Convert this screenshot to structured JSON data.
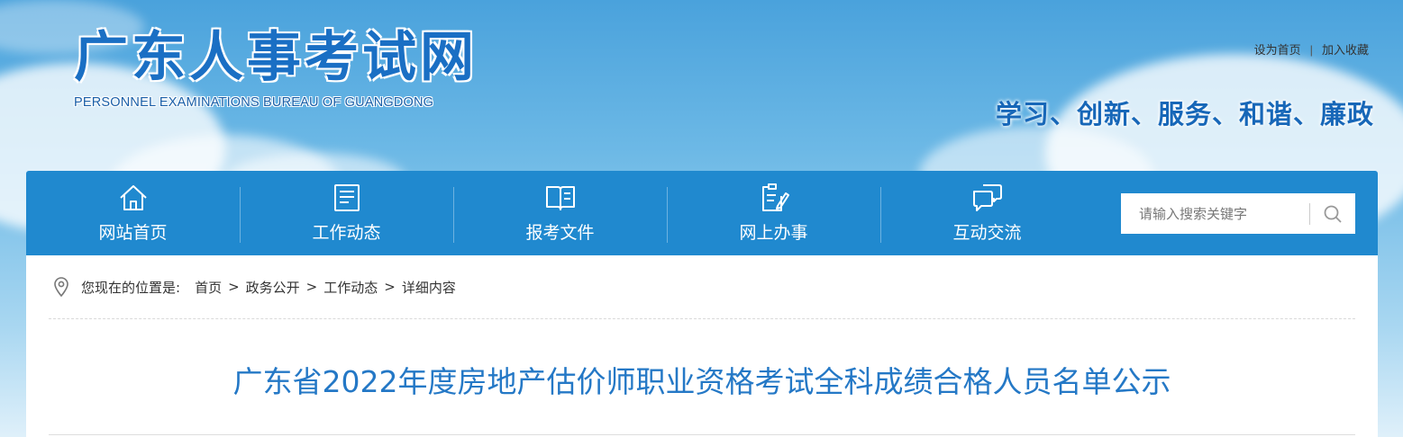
{
  "header": {
    "logo_cn": "广东人事考试网",
    "logo_en": "PERSONNEL EXAMINATIONS BUREAU OF GUANGDONG",
    "links": {
      "set_home": "设为首页",
      "separator": "|",
      "add_favorite": "加入收藏"
    },
    "slogan": "学习、创新、服务、和谐、廉政"
  },
  "nav": {
    "items": [
      {
        "label": "网站首页",
        "icon": "home-icon"
      },
      {
        "label": "工作动态",
        "icon": "news-icon"
      },
      {
        "label": "报考文件",
        "icon": "book-icon"
      },
      {
        "label": "网上办事",
        "icon": "edit-document-icon"
      },
      {
        "label": "互动交流",
        "icon": "chat-icon"
      }
    ],
    "search": {
      "placeholder": "请输入搜索关键字",
      "icon": "search-icon"
    }
  },
  "breadcrumb": {
    "icon": "location-pin-icon",
    "lead": "您现在的位置是:",
    "items": [
      "首页",
      "政务公开",
      "工作动态",
      "详细内容"
    ],
    "separator": ">"
  },
  "article": {
    "title": "广东省2022年度房地产估价师职业资格考试全科成绩合格人员名单公示"
  },
  "colors": {
    "nav_bg": "#2089cf",
    "title": "#2478c6",
    "logo": "#1a6fc4"
  }
}
